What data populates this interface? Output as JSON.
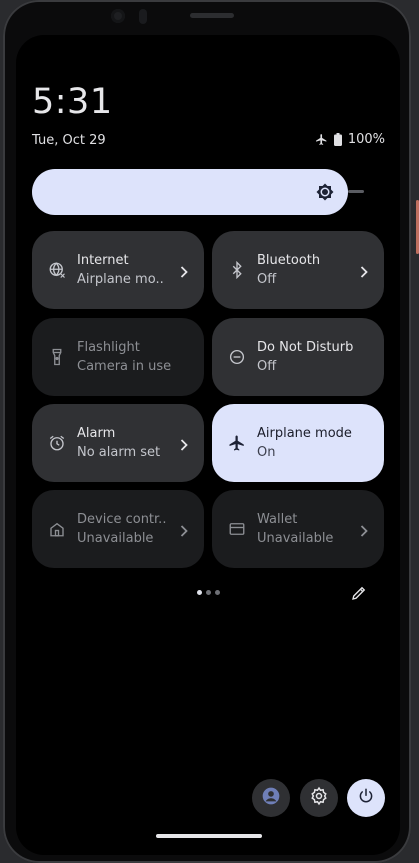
{
  "clock": {
    "time": "5:31",
    "date": "Tue, Oct 29"
  },
  "status_bar": {
    "battery": "100%",
    "airplane_icon": "airplane-icon",
    "battery_icon": "battery-full-icon"
  },
  "brightness": {
    "icon": "brightness-icon",
    "level": 0.88
  },
  "tiles": [
    {
      "label": "Internet",
      "sub": "Airplane mo..",
      "icon": "globe-icon",
      "state": "normal",
      "chevron": true
    },
    {
      "label": "Bluetooth",
      "sub": "Off",
      "icon": "bluetooth-icon",
      "state": "normal",
      "chevron": true
    },
    {
      "label": "Flashlight",
      "sub": "Camera in use",
      "icon": "flashlight-icon",
      "state": "unavailable",
      "chevron": false
    },
    {
      "label": "Do Not Disturb",
      "sub": "Off",
      "icon": "do-not-disturb-icon",
      "state": "normal",
      "chevron": false
    },
    {
      "label": "Alarm",
      "sub": "No alarm set",
      "icon": "alarm-icon",
      "state": "normal",
      "chevron": true
    },
    {
      "label": "Airplane mode",
      "sub": "On",
      "icon": "airplane-icon",
      "state": "active",
      "chevron": false
    },
    {
      "label": "Device contr..",
      "sub": "Unavailable",
      "icon": "home-icon",
      "state": "unavailable",
      "chevron": true
    },
    {
      "label": "Wallet",
      "sub": "Unavailable",
      "icon": "wallet-icon",
      "state": "unavailable",
      "chevron": true
    }
  ],
  "pager": {
    "pages": 3,
    "current": 1
  },
  "footer": {
    "user_icon": "user-icon",
    "settings_icon": "settings-icon",
    "power_icon": "power-icon",
    "edit_icon": "edit-pencil-icon"
  },
  "colors": {
    "accent": "#dde3fb",
    "tile": "#303134",
    "tile_unavailable": "#1b1c1e",
    "background": "#000000"
  }
}
